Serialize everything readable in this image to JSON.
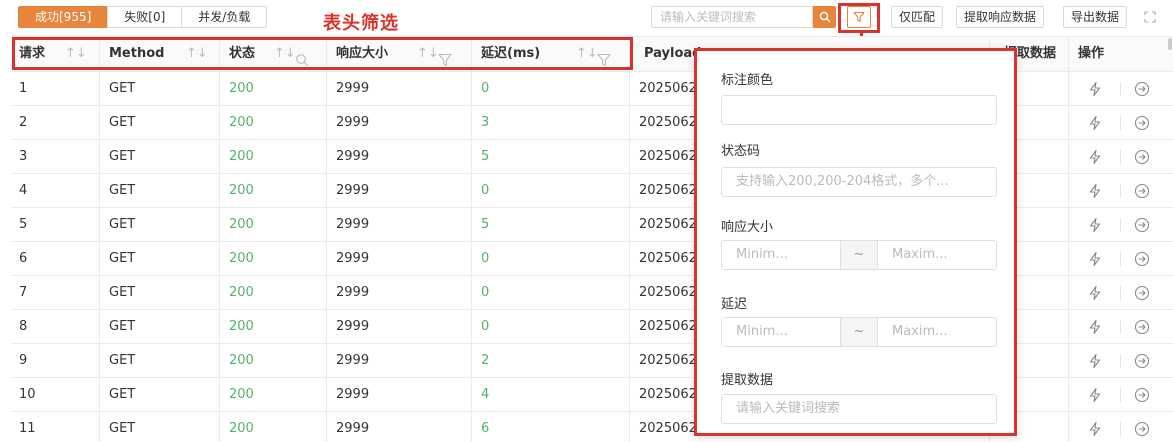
{
  "tabs": [
    {
      "label": "成功[955]",
      "active": true
    },
    {
      "label": "失败[0]",
      "active": false
    },
    {
      "label": "并发/负载",
      "active": false
    }
  ],
  "annotation_label": "表头筛选",
  "search": {
    "placeholder": "请输入关键词搜索"
  },
  "toolbar_buttons": {
    "only_match": "仅匹配",
    "extract_response": "提取响应数据",
    "export": "导出数据"
  },
  "columns": {
    "request": "请求",
    "method": "Method",
    "status": "状态",
    "size": "响应大小",
    "latency": "延迟(ms)",
    "payload": "Payloads",
    "extract": "提取数据",
    "actions": "操作"
  },
  "rows": [
    {
      "request": "1",
      "method": "GET",
      "status": "200",
      "size": "2999",
      "latency": "0",
      "payload": "2025062"
    },
    {
      "request": "2",
      "method": "GET",
      "status": "200",
      "size": "2999",
      "latency": "3",
      "payload": "2025062"
    },
    {
      "request": "3",
      "method": "GET",
      "status": "200",
      "size": "2999",
      "latency": "5",
      "payload": "2025062"
    },
    {
      "request": "4",
      "method": "GET",
      "status": "200",
      "size": "2999",
      "latency": "0",
      "payload": "2025062"
    },
    {
      "request": "5",
      "method": "GET",
      "status": "200",
      "size": "2999",
      "latency": "5",
      "payload": "2025062"
    },
    {
      "request": "6",
      "method": "GET",
      "status": "200",
      "size": "2999",
      "latency": "0",
      "payload": "2025062"
    },
    {
      "request": "7",
      "method": "GET",
      "status": "200",
      "size": "2999",
      "latency": "0",
      "payload": "2025062"
    },
    {
      "request": "8",
      "method": "GET",
      "status": "200",
      "size": "2999",
      "latency": "0",
      "payload": "2025062"
    },
    {
      "request": "9",
      "method": "GET",
      "status": "200",
      "size": "2999",
      "latency": "2",
      "payload": "2025062"
    },
    {
      "request": "10",
      "method": "GET",
      "status": "200",
      "size": "2999",
      "latency": "4",
      "payload": "2025062"
    },
    {
      "request": "11",
      "method": "GET",
      "status": "200",
      "size": "2999",
      "latency": "6",
      "payload": "2025062"
    }
  ],
  "filter_panel": {
    "color_label": "标注颜色",
    "status_label": "状态码",
    "status_placeholder": "支持输入200,200-204格式，多个...",
    "size_label": "响应大小",
    "size_min_placeholder": "Minim...",
    "size_max_placeholder": "Maxim...",
    "range_sep": "~",
    "latency_label": "延迟",
    "latency_min_placeholder": "Minim...",
    "latency_max_placeholder": "Maxim...",
    "extract_label": "提取数据",
    "extract_placeholder": "请输入关键词搜索"
  },
  "colors": {
    "accent": "#e8853d",
    "annotation": "#d9342b",
    "success": "#52b26c"
  }
}
